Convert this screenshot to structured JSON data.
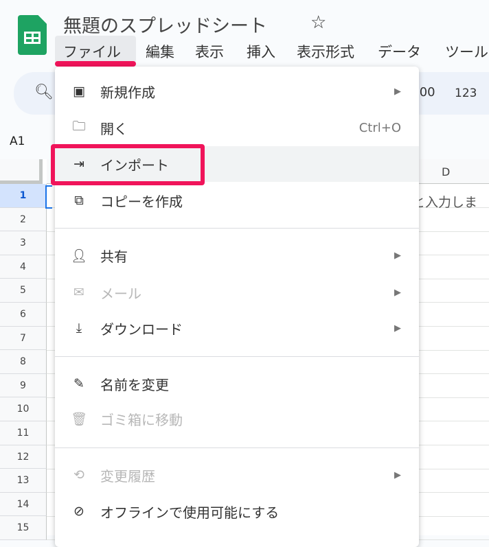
{
  "header": {
    "title": "無題のスプレッドシート",
    "star_icon": "star-outline-icon"
  },
  "menubar": [
    "ファイル",
    "編集",
    "表示",
    "挿入",
    "表示形式",
    "データ",
    "ツール"
  ],
  "toolbar": {
    "decimal": ".00",
    "format": "123"
  },
  "name_box": "A1",
  "grid": {
    "column": "D",
    "rows": [
      "1",
      "2",
      "3",
      "4",
      "5",
      "6",
      "7",
      "8",
      "9",
      "10",
      "11",
      "12",
      "13",
      "14",
      "15"
    ],
    "cell_text": "と入力しま"
  },
  "file_menu": {
    "items": [
      {
        "label": "新規作成",
        "icon": "new-sheet-icon",
        "submenu": true
      },
      {
        "label": "開く",
        "icon": "folder-icon",
        "shortcut": "Ctrl+O"
      },
      {
        "label": "インポート",
        "icon": "import-icon",
        "hovered": true
      },
      {
        "label": "コピーを作成",
        "icon": "copy-icon"
      },
      {
        "label": "共有",
        "icon": "person-add-icon",
        "submenu": true
      },
      {
        "label": "メール",
        "icon": "mail-icon",
        "submenu": true,
        "disabled": true
      },
      {
        "label": "ダウンロード",
        "icon": "download-icon",
        "submenu": true
      },
      {
        "label": "名前を変更",
        "icon": "rename-icon"
      },
      {
        "label": "ゴミ箱に移動",
        "icon": "trash-icon",
        "disabled": true
      },
      {
        "label": "変更履歴",
        "icon": "history-icon",
        "submenu": true,
        "disabled": true
      },
      {
        "label": "オフラインで使用可能にする",
        "icon": "offline-icon"
      }
    ]
  },
  "colors": {
    "highlight": "#f0145a",
    "logo": "#1ea362"
  }
}
